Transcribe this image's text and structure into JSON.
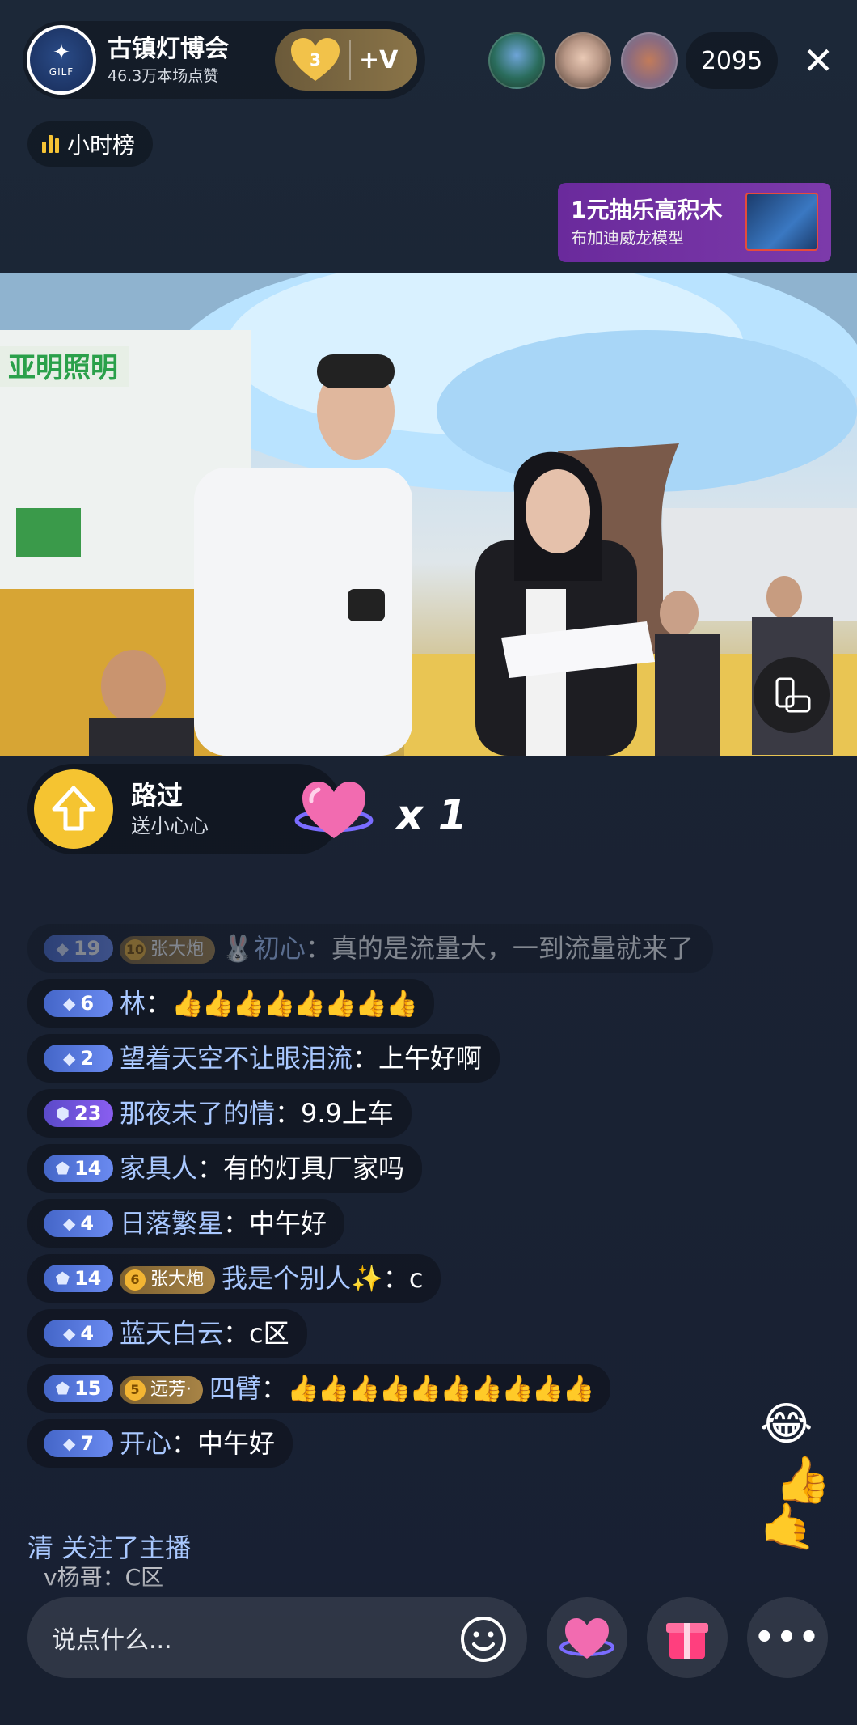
{
  "host": {
    "name": "古镇灯博会",
    "likes": "46.3万本场点赞",
    "avatar_label": "GILF",
    "fan_level": "3",
    "join_label": "+V"
  },
  "viewers": {
    "count": "2095"
  },
  "close_icon": "close-icon",
  "rank": {
    "label": "小时榜"
  },
  "promo": {
    "title": "1元抽乐高积木",
    "subtitle": "布加迪威龙模型"
  },
  "gift": {
    "user": "路过",
    "action": "送小心心",
    "count": "x 1"
  },
  "chat": [
    {
      "level": "19",
      "fan_level": "10",
      "fan_name": "张大炮",
      "user": "初心",
      "text": "：真的是流量大，一到流量就来了",
      "faded": true
    },
    {
      "level": "6",
      "user": "林",
      "text": "：",
      "thumbs": 8
    },
    {
      "level": "2",
      "user": "望着天空不让眼泪流",
      "text": "：上午好啊"
    },
    {
      "level": "23",
      "user": "那夜未了的情",
      "text": "：9.9上车"
    },
    {
      "level": "14",
      "user": "家具人",
      "text": "：有的灯具厂家吗"
    },
    {
      "level": "4",
      "user": "日落繁星",
      "text": "：中午好"
    },
    {
      "level": "14",
      "fan_level": "6",
      "fan_name": "张大炮",
      "user": "我是个别人✨",
      "text": "：c"
    },
    {
      "level": "4",
      "user": "蓝天白云",
      "text": "：c区"
    },
    {
      "level": "15",
      "fan_level": "5",
      "fan_name": "远芳·",
      "user": "四臂",
      "text": "：",
      "thumbs": 10
    },
    {
      "level": "7",
      "user": "开心",
      "text": "：中午好"
    }
  ],
  "follow_notice": "清 关注了主播",
  "overlap_notice": "v杨哥：C区",
  "input": {
    "placeholder": "说点什么..."
  },
  "colors": {
    "background": "#1a2333",
    "username": "#a9c8ff",
    "level_badge": "#4466c8",
    "fan_badge": "#a88446",
    "gift_avatar": "#f5c431",
    "promo": "#6a2a9c"
  },
  "icons": {
    "emoji": "emoji-icon",
    "like": "heart-like-icon",
    "gift": "gift-box-icon",
    "more": "more-icon",
    "rotate": "rotate-screen-icon"
  }
}
